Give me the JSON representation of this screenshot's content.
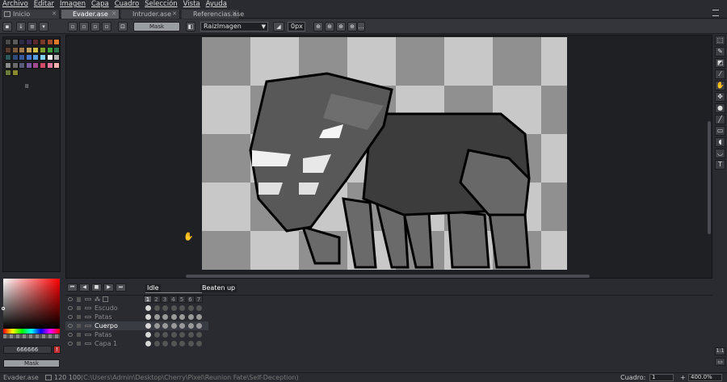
{
  "menu": [
    "Archivo",
    "Editar",
    "Imagen",
    "Capa",
    "Cuadro",
    "Selección",
    "Vista",
    "Ayuda"
  ],
  "tabs": [
    {
      "label": "Inicio",
      "active": false
    },
    {
      "label": "Evader.ase",
      "active": true
    },
    {
      "label": "Intruder.ase",
      "active": false
    },
    {
      "label": "Referencias.ase",
      "active": false
    }
  ],
  "toolbar": {
    "mask_label": "Mask",
    "layer_dropdown": "RaizImagen",
    "offset_value": "0px"
  },
  "palette": {
    "colors": [
      "#4a4a4a",
      "#5a5a5a",
      "#2a2a44",
      "#3a2a55",
      "#5a2a2a",
      "#7a3a2a",
      "#a04a2a",
      "#e07a2a",
      "#5a3a2a",
      "#7a5a3a",
      "#a07a4a",
      "#c0a05a",
      "#d0c04a",
      "#80a030",
      "#40a040",
      "#307a50",
      "#2a5a5a",
      "#304a7a",
      "#3a5aa0",
      "#4a7ad0",
      "#5aa0e0",
      "#80d0f0",
      "#f0f0f0",
      "#b0b0b0",
      "#8a8a8a",
      "#6a6a6a",
      "#5a5a7a",
      "#7a5aa0",
      "#a04a90",
      "#d04a6a",
      "#e07aa0",
      "#f0b0b0",
      "#6a7a3a",
      "#8a8a30"
    ],
    "extra_label": "II"
  },
  "color": {
    "hex_label": "666666",
    "mask_label": "Mask"
  },
  "timeline": {
    "tags": [
      {
        "label": "Idle"
      },
      {
        "label": "Beaten up"
      }
    ],
    "frames": [
      "1",
      "2",
      "3",
      "4",
      "5",
      "6",
      "7"
    ],
    "layers": [
      {
        "name": "Escudo",
        "active": false,
        "cels": [
          1,
          0,
          0,
          0,
          0,
          0,
          0
        ]
      },
      {
        "name": "Patas",
        "active": false,
        "cels": [
          1,
          1,
          1,
          1,
          1,
          1,
          1
        ]
      },
      {
        "name": "Cuerpo",
        "active": true,
        "cels": [
          1,
          1,
          1,
          1,
          1,
          1,
          1
        ]
      },
      {
        "name": "Patas",
        "active": false,
        "cels": [
          1,
          0,
          0,
          0,
          0,
          0,
          0
        ]
      },
      {
        "name": "Capa 1",
        "active": false,
        "cels": [
          1,
          0,
          0,
          0,
          0,
          0,
          0
        ]
      }
    ]
  },
  "status": {
    "filename": "Evader.ase",
    "dims": "120 100",
    "path": "(C:\\Users\\Admin\\Desktop\\Cherry\\Pixel\\Reunion Fate\\Self-Deception)",
    "frame_label": "Cuadro:",
    "frame_value": "1",
    "zoom_value": "400.0%"
  },
  "colors": {
    "accent": "#5e6066",
    "canvas_bg": "#1f2024",
    "checker_light": "#c8c8c8",
    "checker_dark": "#909090",
    "creature_body": "#3c3c3c",
    "creature_head": "#585858"
  }
}
